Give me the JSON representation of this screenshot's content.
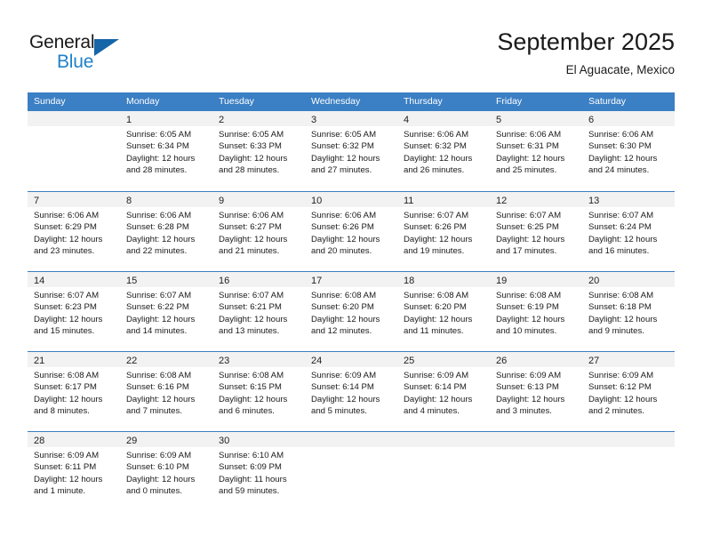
{
  "brand": {
    "name_part1": "General",
    "name_part2": "Blue",
    "triangle_color": "#1565a8",
    "blue_color": "#2081c8"
  },
  "header": {
    "title": "September 2025",
    "subtitle": "El Aguacate, Mexico"
  },
  "theme": {
    "header_row_bg": "#3b7fc4",
    "day_band_bg": "#f2f2f2",
    "cell_bg": "#ffffff",
    "text_color": "#1a1a1a"
  },
  "weekdays": [
    "Sunday",
    "Monday",
    "Tuesday",
    "Wednesday",
    "Thursday",
    "Friday",
    "Saturday"
  ],
  "weeks": [
    [
      {
        "day": "",
        "lines": []
      },
      {
        "day": "1",
        "lines": [
          "Sunrise: 6:05 AM",
          "Sunset: 6:34 PM",
          "Daylight: 12 hours",
          "and 28 minutes."
        ]
      },
      {
        "day": "2",
        "lines": [
          "Sunrise: 6:05 AM",
          "Sunset: 6:33 PM",
          "Daylight: 12 hours",
          "and 28 minutes."
        ]
      },
      {
        "day": "3",
        "lines": [
          "Sunrise: 6:05 AM",
          "Sunset: 6:32 PM",
          "Daylight: 12 hours",
          "and 27 minutes."
        ]
      },
      {
        "day": "4",
        "lines": [
          "Sunrise: 6:06 AM",
          "Sunset: 6:32 PM",
          "Daylight: 12 hours",
          "and 26 minutes."
        ]
      },
      {
        "day": "5",
        "lines": [
          "Sunrise: 6:06 AM",
          "Sunset: 6:31 PM",
          "Daylight: 12 hours",
          "and 25 minutes."
        ]
      },
      {
        "day": "6",
        "lines": [
          "Sunrise: 6:06 AM",
          "Sunset: 6:30 PM",
          "Daylight: 12 hours",
          "and 24 minutes."
        ]
      }
    ],
    [
      {
        "day": "7",
        "lines": [
          "Sunrise: 6:06 AM",
          "Sunset: 6:29 PM",
          "Daylight: 12 hours",
          "and 23 minutes."
        ]
      },
      {
        "day": "8",
        "lines": [
          "Sunrise: 6:06 AM",
          "Sunset: 6:28 PM",
          "Daylight: 12 hours",
          "and 22 minutes."
        ]
      },
      {
        "day": "9",
        "lines": [
          "Sunrise: 6:06 AM",
          "Sunset: 6:27 PM",
          "Daylight: 12 hours",
          "and 21 minutes."
        ]
      },
      {
        "day": "10",
        "lines": [
          "Sunrise: 6:06 AM",
          "Sunset: 6:26 PM",
          "Daylight: 12 hours",
          "and 20 minutes."
        ]
      },
      {
        "day": "11",
        "lines": [
          "Sunrise: 6:07 AM",
          "Sunset: 6:26 PM",
          "Daylight: 12 hours",
          "and 19 minutes."
        ]
      },
      {
        "day": "12",
        "lines": [
          "Sunrise: 6:07 AM",
          "Sunset: 6:25 PM",
          "Daylight: 12 hours",
          "and 17 minutes."
        ]
      },
      {
        "day": "13",
        "lines": [
          "Sunrise: 6:07 AM",
          "Sunset: 6:24 PM",
          "Daylight: 12 hours",
          "and 16 minutes."
        ]
      }
    ],
    [
      {
        "day": "14",
        "lines": [
          "Sunrise: 6:07 AM",
          "Sunset: 6:23 PM",
          "Daylight: 12 hours",
          "and 15 minutes."
        ]
      },
      {
        "day": "15",
        "lines": [
          "Sunrise: 6:07 AM",
          "Sunset: 6:22 PM",
          "Daylight: 12 hours",
          "and 14 minutes."
        ]
      },
      {
        "day": "16",
        "lines": [
          "Sunrise: 6:07 AM",
          "Sunset: 6:21 PM",
          "Daylight: 12 hours",
          "and 13 minutes."
        ]
      },
      {
        "day": "17",
        "lines": [
          "Sunrise: 6:08 AM",
          "Sunset: 6:20 PM",
          "Daylight: 12 hours",
          "and 12 minutes."
        ]
      },
      {
        "day": "18",
        "lines": [
          "Sunrise: 6:08 AM",
          "Sunset: 6:20 PM",
          "Daylight: 12 hours",
          "and 11 minutes."
        ]
      },
      {
        "day": "19",
        "lines": [
          "Sunrise: 6:08 AM",
          "Sunset: 6:19 PM",
          "Daylight: 12 hours",
          "and 10 minutes."
        ]
      },
      {
        "day": "20",
        "lines": [
          "Sunrise: 6:08 AM",
          "Sunset: 6:18 PM",
          "Daylight: 12 hours",
          "and 9 minutes."
        ]
      }
    ],
    [
      {
        "day": "21",
        "lines": [
          "Sunrise: 6:08 AM",
          "Sunset: 6:17 PM",
          "Daylight: 12 hours",
          "and 8 minutes."
        ]
      },
      {
        "day": "22",
        "lines": [
          "Sunrise: 6:08 AM",
          "Sunset: 6:16 PM",
          "Daylight: 12 hours",
          "and 7 minutes."
        ]
      },
      {
        "day": "23",
        "lines": [
          "Sunrise: 6:08 AM",
          "Sunset: 6:15 PM",
          "Daylight: 12 hours",
          "and 6 minutes."
        ]
      },
      {
        "day": "24",
        "lines": [
          "Sunrise: 6:09 AM",
          "Sunset: 6:14 PM",
          "Daylight: 12 hours",
          "and 5 minutes."
        ]
      },
      {
        "day": "25",
        "lines": [
          "Sunrise: 6:09 AM",
          "Sunset: 6:14 PM",
          "Daylight: 12 hours",
          "and 4 minutes."
        ]
      },
      {
        "day": "26",
        "lines": [
          "Sunrise: 6:09 AM",
          "Sunset: 6:13 PM",
          "Daylight: 12 hours",
          "and 3 minutes."
        ]
      },
      {
        "day": "27",
        "lines": [
          "Sunrise: 6:09 AM",
          "Sunset: 6:12 PM",
          "Daylight: 12 hours",
          "and 2 minutes."
        ]
      }
    ],
    [
      {
        "day": "28",
        "lines": [
          "Sunrise: 6:09 AM",
          "Sunset: 6:11 PM",
          "Daylight: 12 hours",
          "and 1 minute."
        ]
      },
      {
        "day": "29",
        "lines": [
          "Sunrise: 6:09 AM",
          "Sunset: 6:10 PM",
          "Daylight: 12 hours",
          "and 0 minutes."
        ]
      },
      {
        "day": "30",
        "lines": [
          "Sunrise: 6:10 AM",
          "Sunset: 6:09 PM",
          "Daylight: 11 hours",
          "and 59 minutes."
        ]
      },
      {
        "day": "",
        "lines": []
      },
      {
        "day": "",
        "lines": []
      },
      {
        "day": "",
        "lines": []
      },
      {
        "day": "",
        "lines": []
      }
    ]
  ]
}
